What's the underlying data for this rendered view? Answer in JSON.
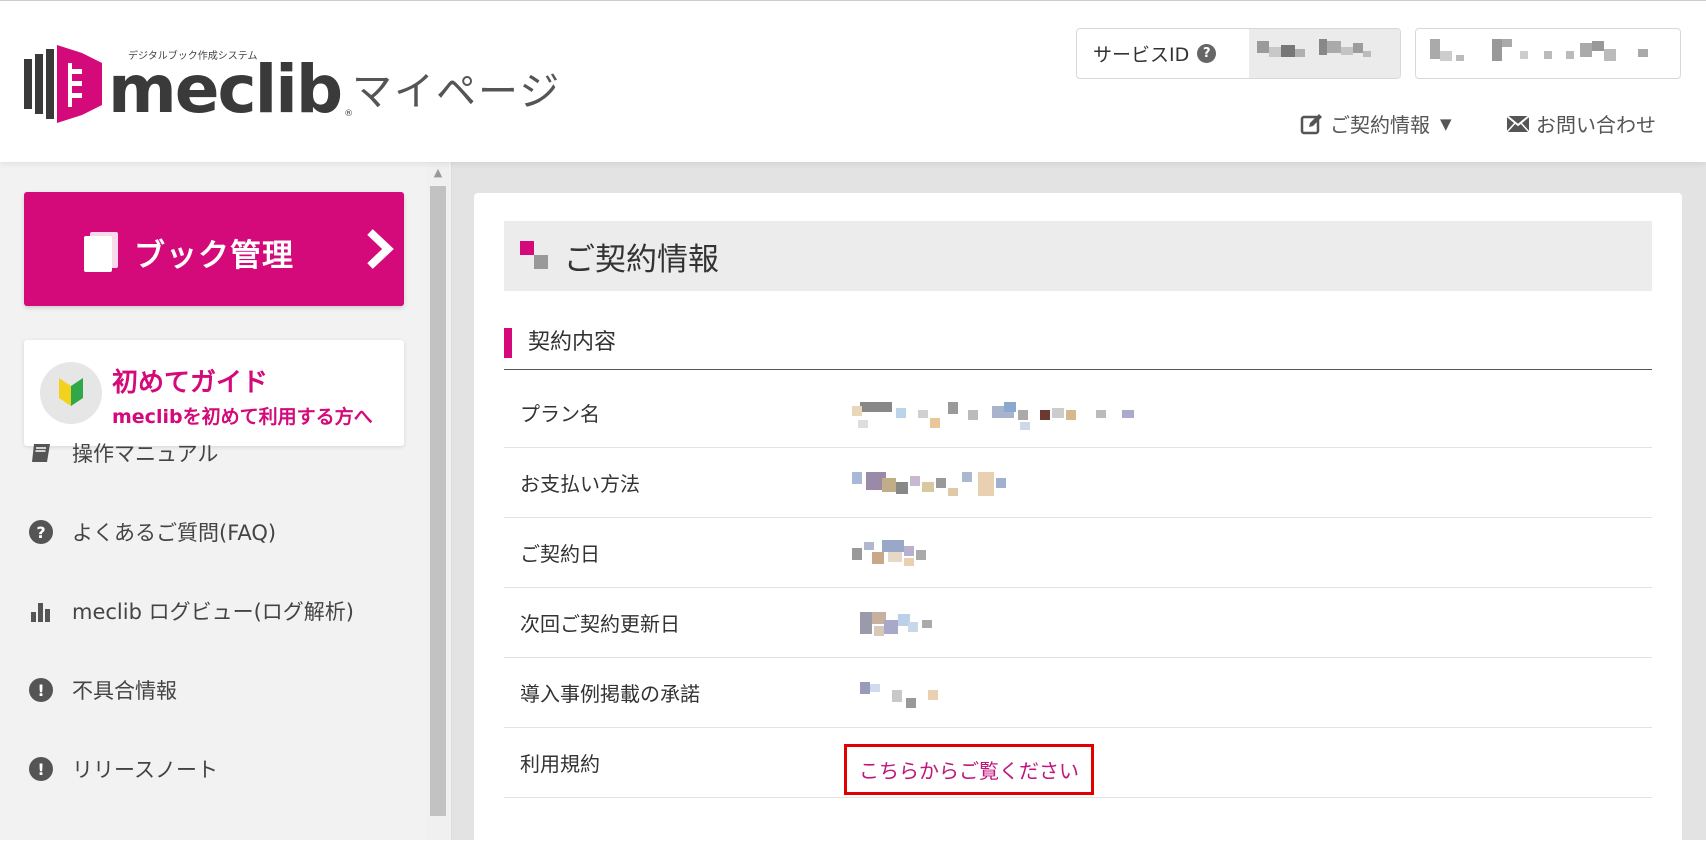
{
  "header": {
    "logo_text": "meclib",
    "logo_subtext": "デジタルブック作成システム",
    "logo_reg": "®",
    "page_title": "マイページ",
    "service_id_label": "サービスID",
    "help_glyph": "?",
    "nav_contract": "ご契約情報",
    "nav_contact": "お問い合わせ"
  },
  "sidebar": {
    "book_button": "ブック管理",
    "guide_title": "初めてガイド",
    "guide_subtitle": "meclibを初めて利用する方へ",
    "items": [
      {
        "label": "操作マニュアル",
        "icon": "book-icon"
      },
      {
        "label": "よくあるご質問(FAQ)",
        "icon": "question-circle-icon"
      },
      {
        "label": "meclib ログビュー(ログ解析)",
        "icon": "bar-chart-icon"
      },
      {
        "label": "不具合情報",
        "icon": "exclamation-circle-icon"
      },
      {
        "label": "リリースノート",
        "icon": "exclamation-circle-icon"
      }
    ]
  },
  "main": {
    "card_title": "ご契約情報",
    "section_title": "契約内容",
    "rows": [
      {
        "label": "プラン名"
      },
      {
        "label": "お支払い方法"
      },
      {
        "label": "ご契約日"
      },
      {
        "label": "次回ご契約更新日"
      },
      {
        "label": "導入事例掲載の承諾"
      },
      {
        "label": "利用規約",
        "link": "こちらからご覧ください"
      }
    ]
  },
  "colors": {
    "brand": "#d4097a",
    "highlight_box": "#e00000",
    "link": "#c0157c"
  }
}
